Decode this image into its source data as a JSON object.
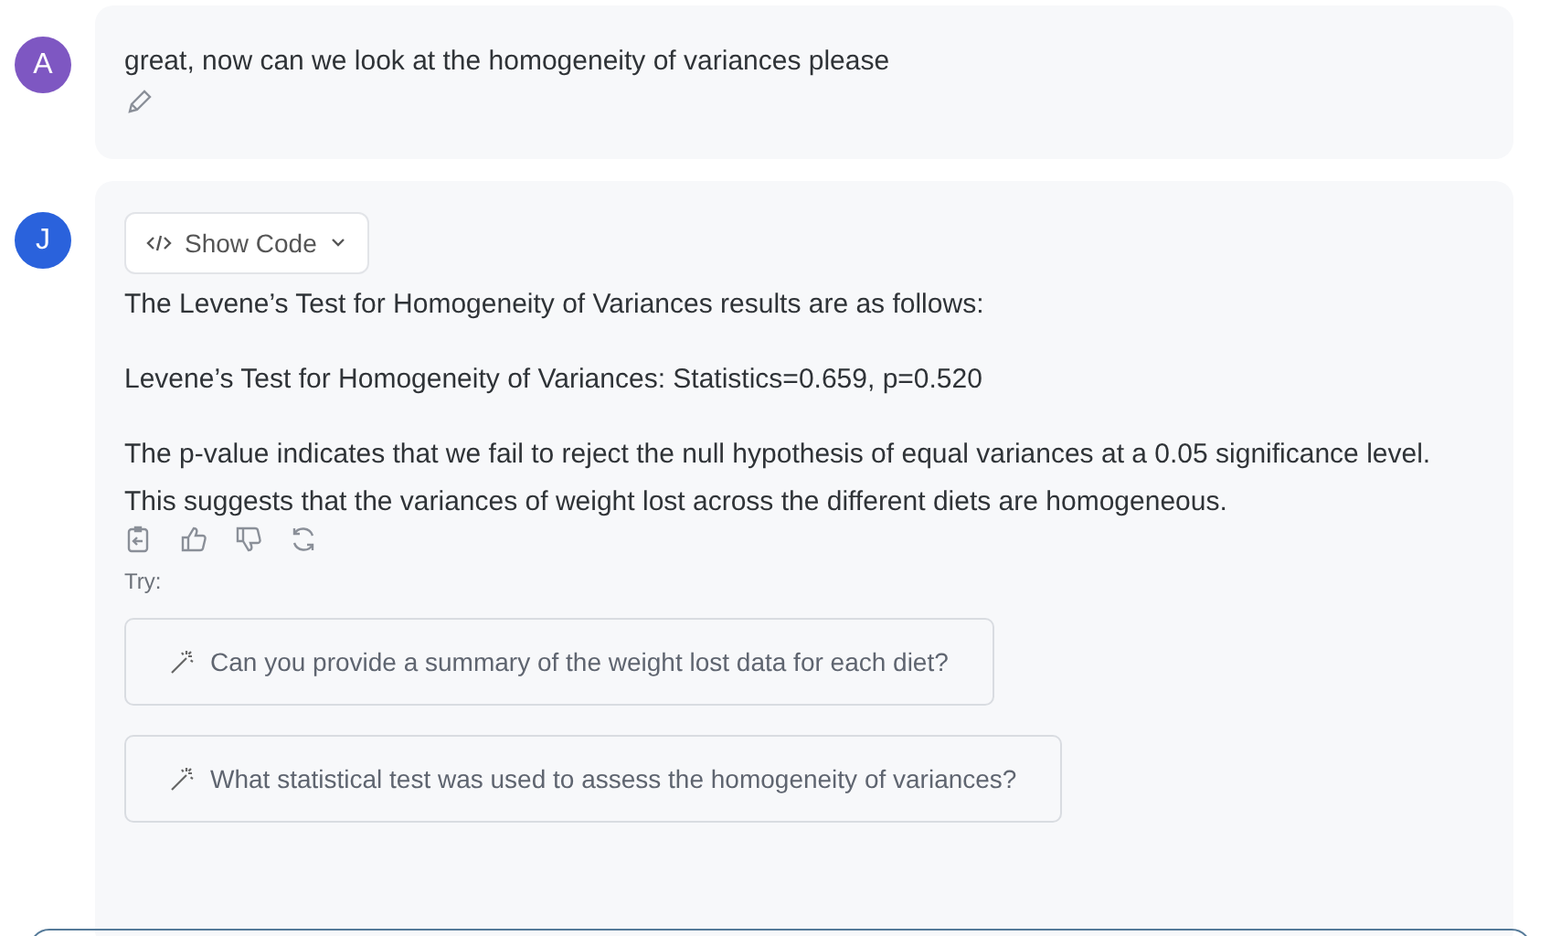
{
  "messages": [
    {
      "kind": "user",
      "avatar": {
        "letter": "A",
        "color": "#7e57c2"
      },
      "text": "great, now can we look at the homogeneity of variances please"
    },
    {
      "kind": "assistant",
      "avatar": {
        "letter": "J",
        "color": "#2a62dc"
      },
      "show_code": "Show Code",
      "paragraphs": [
        "The Levene’s Test for Homogeneity of Variances results are as follows:",
        "Levene’s Test for Homogeneity of Variances: Statistics=0.659, p=0.520",
        "The p-value indicates that we fail to reject the null hypothesis of equal variances at a 0.05 significance level. This suggests that the variances of weight lost across the different diets are homogeneous."
      ],
      "try_label": "Try:",
      "suggestions": [
        "Can you provide a summary of the weight lost data for each diet?",
        "What statistical test was used to assess the homogeneity of variances?"
      ]
    }
  ]
}
